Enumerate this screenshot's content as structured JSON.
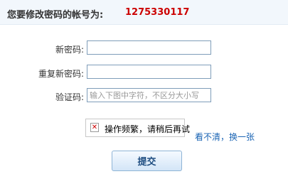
{
  "header": {
    "title": "您要修改密码的帐号为:",
    "account": "1275330117"
  },
  "form": {
    "new_password_label": "新密码:",
    "confirm_password_label": "重复新密码:",
    "captcha_label": "验证码:",
    "captcha_placeholder": "输入下图中字符，不区分大小写",
    "captcha_image_text": "操作频繁，请稍后再试",
    "refresh_link": "看不清，换一张",
    "submit_label": "提交"
  },
  "colors": {
    "account": "#cc0000",
    "link": "#1a64b4",
    "header_bg": "#f2f7fc"
  },
  "icons": {
    "captcha_error": "broken-image-icon"
  }
}
